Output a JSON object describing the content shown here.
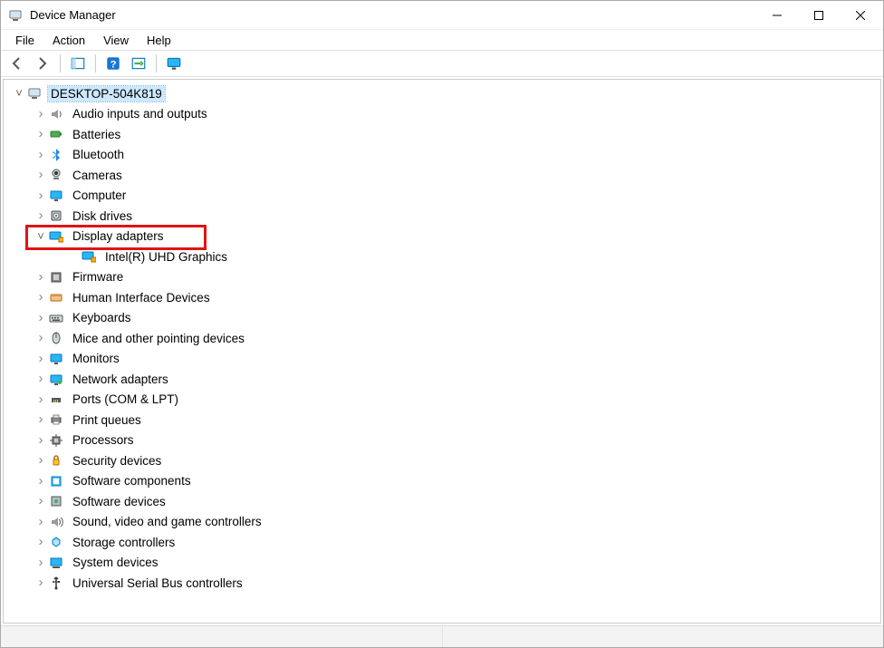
{
  "window": {
    "title": "Device Manager"
  },
  "menu": {
    "file": "File",
    "action": "Action",
    "view": "View",
    "help": "Help"
  },
  "tree": {
    "root": {
      "label": "DESKTOP-504K819",
      "expanded": true,
      "selected": true,
      "icon": "computer"
    },
    "nodes": [
      {
        "label": "Audio inputs and outputs",
        "icon": "audio",
        "expanded": false
      },
      {
        "label": "Batteries",
        "icon": "battery",
        "expanded": false
      },
      {
        "label": "Bluetooth",
        "icon": "bluetooth",
        "expanded": false
      },
      {
        "label": "Cameras",
        "icon": "camera",
        "expanded": false
      },
      {
        "label": "Computer",
        "icon": "monitor",
        "expanded": false
      },
      {
        "label": "Disk drives",
        "icon": "disk",
        "expanded": false
      },
      {
        "label": "Display adapters",
        "icon": "display",
        "expanded": true,
        "highlighted": true,
        "children": [
          {
            "label": "Intel(R) UHD Graphics",
            "icon": "display"
          }
        ]
      },
      {
        "label": "Firmware",
        "icon": "firmware",
        "expanded": false
      },
      {
        "label": "Human Interface Devices",
        "icon": "hid",
        "expanded": false
      },
      {
        "label": "Keyboards",
        "icon": "keyboard",
        "expanded": false
      },
      {
        "label": "Mice and other pointing devices",
        "icon": "mouse",
        "expanded": false
      },
      {
        "label": "Monitors",
        "icon": "monitor",
        "expanded": false
      },
      {
        "label": "Network adapters",
        "icon": "network",
        "expanded": false
      },
      {
        "label": "Ports (COM & LPT)",
        "icon": "port",
        "expanded": false
      },
      {
        "label": "Print queues",
        "icon": "printer",
        "expanded": false
      },
      {
        "label": "Processors",
        "icon": "cpu",
        "expanded": false
      },
      {
        "label": "Security devices",
        "icon": "security",
        "expanded": false
      },
      {
        "label": "Software components",
        "icon": "software-comp",
        "expanded": false
      },
      {
        "label": "Software devices",
        "icon": "software-dev",
        "expanded": false
      },
      {
        "label": "Sound, video and game controllers",
        "icon": "sound",
        "expanded": false
      },
      {
        "label": "Storage controllers",
        "icon": "storage",
        "expanded": false
      },
      {
        "label": "System devices",
        "icon": "system",
        "expanded": false
      },
      {
        "label": "Universal Serial Bus controllers",
        "icon": "usb",
        "expanded": false
      }
    ]
  },
  "annotation": {
    "highlight_target": "Display adapters"
  }
}
